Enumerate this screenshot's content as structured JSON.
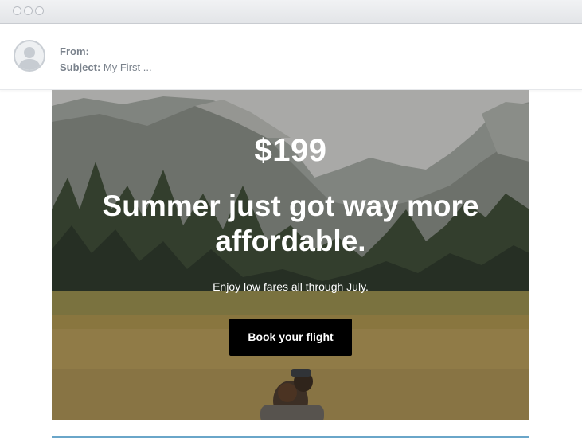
{
  "window": {
    "controls": [
      "close-dot",
      "minimize-dot",
      "zoom-dot"
    ]
  },
  "email": {
    "from_label": "From:",
    "from_value": "",
    "subject_label": "Subject:",
    "subject_value": "My First ..."
  },
  "hero": {
    "price": "$199",
    "headline": "Summer just got way more affordable.",
    "subline": "Enjoy low fares all through July.",
    "cta_label": "Book your flight"
  },
  "colors": {
    "cta_background": "#000000",
    "accent_rule": "#6aa6c9"
  }
}
